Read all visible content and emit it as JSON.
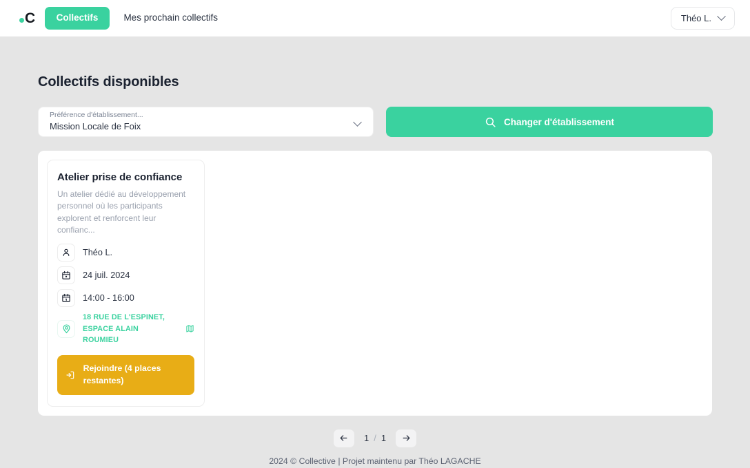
{
  "header": {
    "logo": {
      "letter": "C",
      "icon": "green-dot-icon"
    },
    "nav": [
      {
        "label": "Collectifs",
        "active": true
      },
      {
        "label": "Mes prochain collectifs",
        "active": false
      }
    ],
    "user": {
      "name": "Théo L.",
      "chevron_icon": "chevron-down-icon"
    }
  },
  "main": {
    "title": "Collectifs disponibles",
    "establishment_select": {
      "label": "Préférence d'établissement...",
      "value": "Mission Locale de Foix",
      "chevron_icon": "chevron-down-icon"
    },
    "change_button": {
      "label": "Changer d'établissement",
      "icon": "search-icon"
    },
    "cards": [
      {
        "title": "Atelier prise de confiance",
        "description": "Un atelier dédié au développement personnel où les participants explorent et renforcent leur confianc...",
        "organizer": {
          "icon": "user-icon",
          "text": "Théo L."
        },
        "date": {
          "icon": "calendar-icon",
          "text": "24 juil. 2024"
        },
        "time": {
          "icon": "calendar-clock-icon",
          "text": "14:00 - 16:00"
        },
        "address": {
          "icon": "map-pin-icon",
          "text": "18 RUE DE L'ESPINET, ESPACE ALAIN ROUMIEU",
          "map_link_icon": "map-external-link-icon"
        },
        "join_button": {
          "label": "Rejoindre (4 places restantes)",
          "icon": "login-arrow-icon"
        }
      }
    ],
    "pagination": {
      "prev_icon": "arrow-left-icon",
      "next_icon": "arrow-right-icon",
      "current": "1",
      "separator": "/",
      "total": "1"
    }
  },
  "footer": {
    "text": "2024 © Collective | Projet maintenu par Théo LAGACHE"
  },
  "colors": {
    "accent_green": "#3ad29f",
    "amber": "#e8ad16",
    "background": "#e5e5e5",
    "text_dark": "#1b2230"
  }
}
